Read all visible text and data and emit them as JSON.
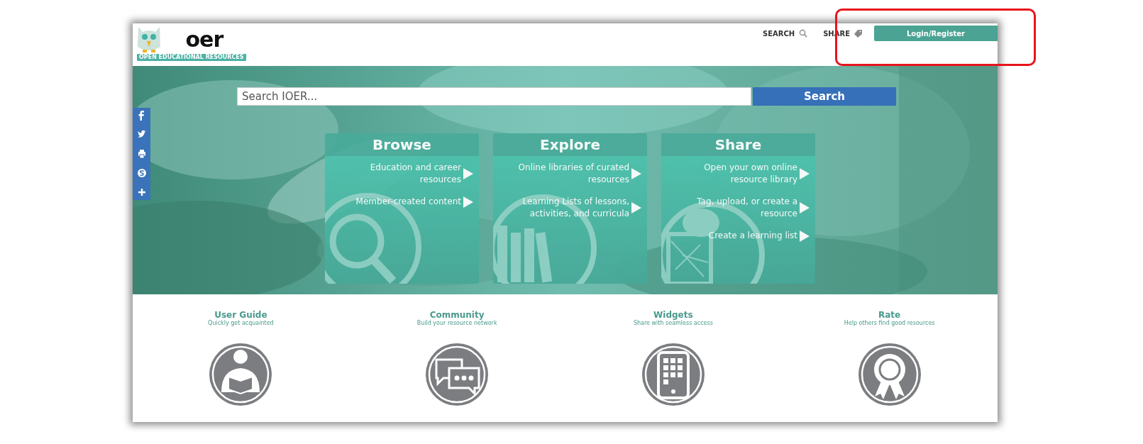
{
  "header": {
    "logo": {
      "wordmark": "oer",
      "tagline": "OPEN EDUCATIONAL RESOURCES"
    },
    "nav": [
      {
        "label": "SEARCH",
        "kind": "search"
      },
      {
        "label": "SHARE",
        "kind": "tag"
      }
    ],
    "login_button": "Login/Register"
  },
  "social_bar": [
    {
      "kind": "facebook"
    },
    {
      "kind": "twitter"
    },
    {
      "kind": "print"
    },
    {
      "kind": "skype"
    },
    {
      "kind": "more"
    }
  ],
  "hero": {
    "search": {
      "placeholder": "Search IOER...",
      "button": "Search"
    },
    "cards": [
      {
        "title": "Browse",
        "kind": "magnifier",
        "links": [
          "Education and career resources",
          "Member-created content"
        ]
      },
      {
        "title": "Explore",
        "kind": "books",
        "links": [
          "Online libraries of curated resources",
          "Learning Lists of lessons, activities, and curricula"
        ]
      },
      {
        "title": "Share",
        "kind": "network",
        "links": [
          "Open your own online resource library",
          "Tag, upload, or create a resource",
          "Create a learning list"
        ]
      }
    ]
  },
  "features": [
    {
      "title": "User Guide",
      "subtitle": "Quickly get acquainted",
      "kind": "reader"
    },
    {
      "title": "Community",
      "subtitle": "Build your resource network",
      "kind": "chat"
    },
    {
      "title": "Widgets",
      "subtitle": "Share with seamless access",
      "kind": "tablet"
    },
    {
      "title": "Rate",
      "subtitle": "Help others find good resources",
      "kind": "ribbon"
    }
  ]
}
